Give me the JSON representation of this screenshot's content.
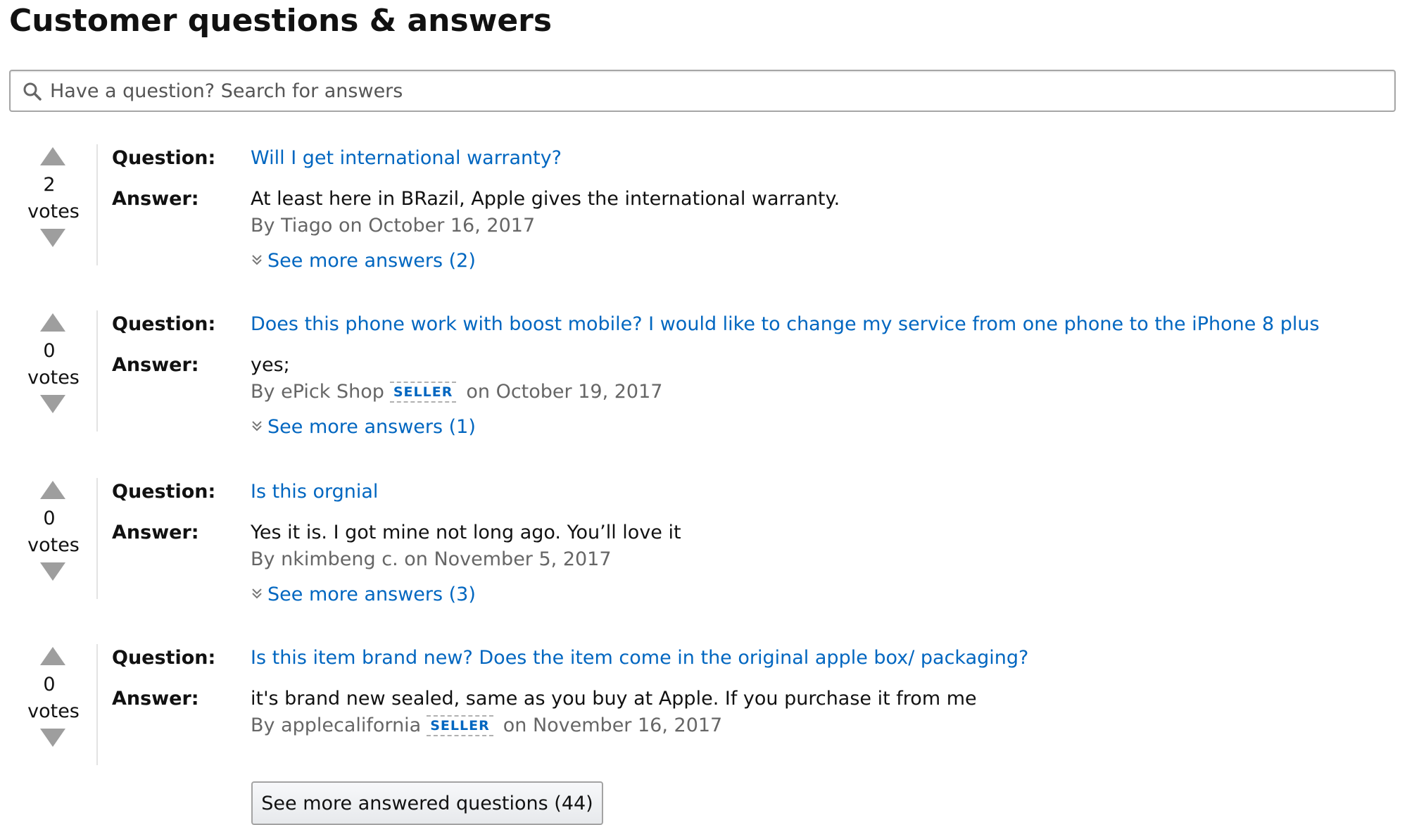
{
  "section": {
    "title": "Customer questions & answers"
  },
  "search": {
    "placeholder": "Have a question? Search for answers",
    "icon": "search-icon"
  },
  "labels": {
    "question": "Question:",
    "answer": "Answer:",
    "votes": "votes",
    "seller": "SELLER"
  },
  "questions": [
    {
      "votes": "2",
      "question": "Will I get international warranty?",
      "answer": "At least here in BRazil, Apple gives the international warranty.",
      "byline_prefix": "By Tiago on October 16, 2017",
      "seller": false,
      "see_more": "See more answers (2)"
    },
    {
      "votes": "0",
      "question": "Does this phone work with boost mobile? I would like to change my service from one phone to the iPhone 8 plus",
      "answer": "yes;",
      "byline_prefix": "By ePick Shop",
      "byline_suffix": "on October 19, 2017",
      "seller": true,
      "see_more": "See more answers (1)"
    },
    {
      "votes": "0",
      "question": "Is this orgnial",
      "answer": "Yes it is. I got mine not long ago. You’ll love it",
      "byline_prefix": "By nkimbeng c. on November 5, 2017",
      "seller": false,
      "see_more": "See more answers (3)"
    },
    {
      "votes": "0",
      "question": "Is this item brand new? Does the item come in the original apple box/ packaging?",
      "answer": "it's brand new sealed, same as you buy at Apple. If you purchase it from me",
      "byline_prefix": "By applecalifornia",
      "byline_suffix": "on November 16, 2017",
      "seller": true,
      "see_more": ""
    }
  ],
  "more_button": {
    "label": "See more answered questions (44)"
  },
  "colors": {
    "link": "#0066c0",
    "text": "#111111",
    "muted": "#666666",
    "vote_arrow": "#9e9e9e"
  }
}
